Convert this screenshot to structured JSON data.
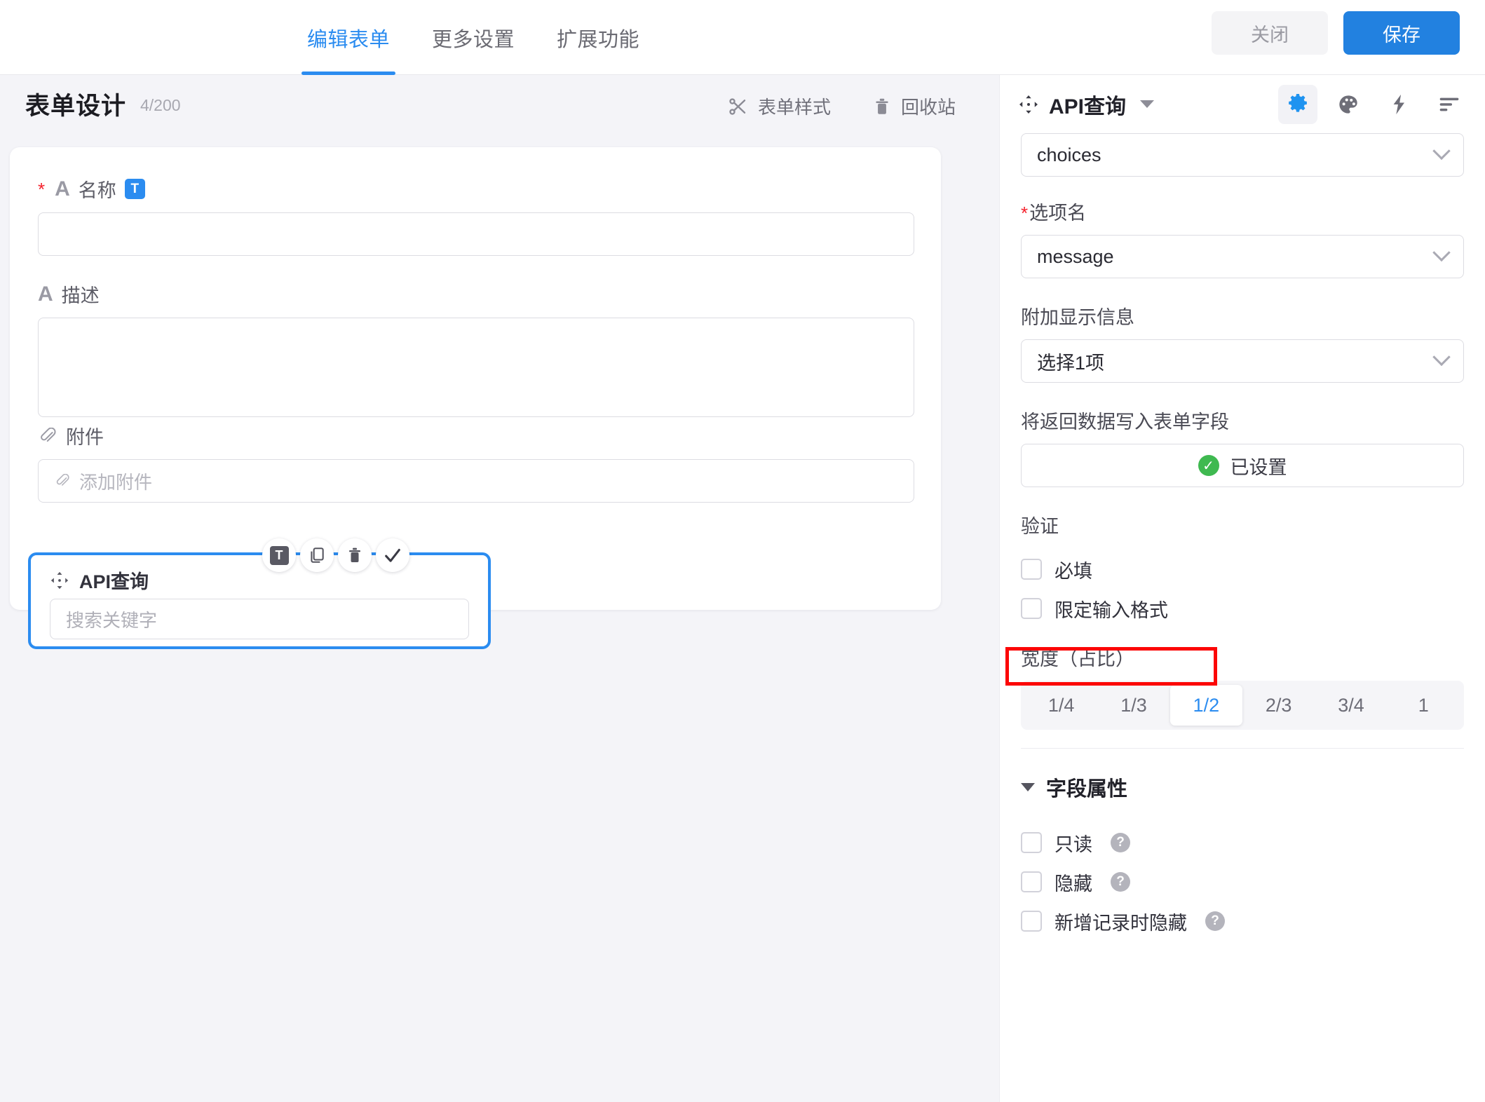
{
  "topbar": {
    "tabs": [
      {
        "label": "编辑表单",
        "active": true
      },
      {
        "label": "更多设置",
        "active": false
      },
      {
        "label": "扩展功能",
        "active": false
      }
    ],
    "close_label": "关闭",
    "save_label": "保存",
    "accent_color": "#2281e0"
  },
  "canvas": {
    "title": "表单设计",
    "counter": "4/200",
    "tools": [
      {
        "label": "表单样式",
        "icon": "scissors-icon"
      },
      {
        "label": "回收站",
        "icon": "trash-icon"
      }
    ],
    "fields": [
      {
        "label": "名称",
        "required": true,
        "type_glyph": "A",
        "badge": "T",
        "value": "",
        "placeholder": ""
      },
      {
        "label": "描述",
        "required": false,
        "type_glyph": "A",
        "value": "",
        "placeholder": ""
      },
      {
        "label": "附件",
        "required": false,
        "icon": "paperclip-icon",
        "placeholder": "添加附件"
      }
    ],
    "selected_field": {
      "label": "API查询",
      "placeholder": "搜索关键字",
      "toolbar": [
        {
          "name": "text-type-icon",
          "glyph": "T"
        },
        {
          "name": "copy-icon"
        },
        {
          "name": "trash-icon"
        },
        {
          "name": "check-icon"
        }
      ],
      "border_color": "#2b8cf0"
    }
  },
  "panel": {
    "title": "API查询",
    "icons": [
      {
        "name": "gear-icon",
        "active": true,
        "color": "#2b8cf0"
      },
      {
        "name": "palette-icon",
        "active": false
      },
      {
        "name": "lightning-icon",
        "active": false
      },
      {
        "name": "align-list-icon",
        "active": false
      }
    ],
    "choices_select": {
      "value": "choices"
    },
    "option_name": {
      "label": "选项名",
      "required": true,
      "value": "message"
    },
    "extra_display": {
      "label": "附加显示信息",
      "value": "选择1项"
    },
    "write_back": {
      "label": "将返回数据写入表单字段",
      "status": "已设置",
      "status_color": "#3fb950"
    },
    "validation": {
      "title": "验证",
      "items": [
        {
          "label": "必填",
          "checked": false
        },
        {
          "label": "限定输入格式",
          "checked": false,
          "highlighted": true
        }
      ]
    },
    "width_ratio": {
      "label": "宽度（占比）",
      "options": [
        "1/4",
        "1/3",
        "1/2",
        "2/3",
        "3/4",
        "1"
      ],
      "selected": "1/2"
    },
    "field_props": {
      "title": "字段属性",
      "expanded": true,
      "items": [
        {
          "label": "只读",
          "checked": false,
          "help": true
        },
        {
          "label": "隐藏",
          "checked": false,
          "help": true
        },
        {
          "label": "新增记录时隐藏",
          "checked": false,
          "help": true
        }
      ]
    }
  },
  "annotation": {
    "color": "#fc0606",
    "target": "限定输入格式"
  }
}
